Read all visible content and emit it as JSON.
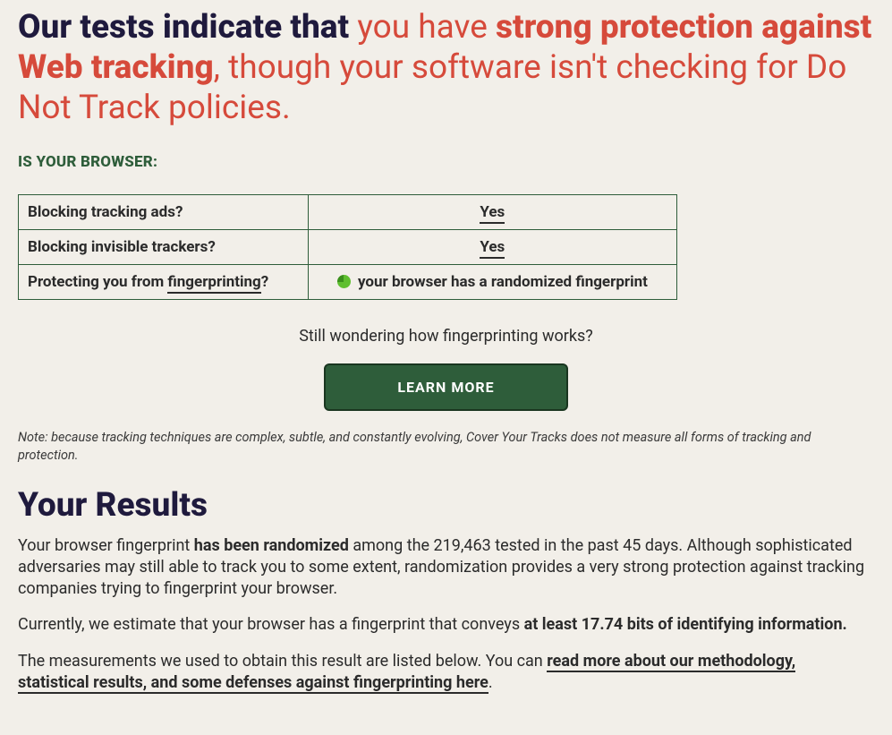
{
  "headline": {
    "lead": "Our tests indicate that ",
    "red1_plain": "you have ",
    "red1_bold": "strong protection against Web tracking",
    "red2_plain": ", though your software isn't checking for Do Not Track policies."
  },
  "section_label": "IS YOUR BROWSER:",
  "table": {
    "rows": [
      {
        "label": "Blocking tracking ads?",
        "value": "Yes"
      },
      {
        "label": "Blocking invisible trackers?",
        "value": "Yes"
      }
    ],
    "fingerprint_row": {
      "label_prefix": "Protecting you from ",
      "label_link": "fingerprinting",
      "label_suffix": "?",
      "value": "your browser has a randomized fingerprint"
    }
  },
  "prompt": "Still wondering how fingerprinting works?",
  "learn_more": "LEARN MORE",
  "note": "Note: because tracking techniques are complex, subtle, and constantly evolving, Cover Your Tracks does not measure all forms of tracking and protection.",
  "results": {
    "heading": "Your Results",
    "p1_a": "Your browser fingerprint ",
    "p1_bold": "has been randomized",
    "p1_b": " among the 219,463 tested in the past 45 days. Although sophisticated adversaries may still able to track you to some extent, randomization provides a very strong protection against tracking companies trying to fingerprint your browser.",
    "p2_a": "Currently, we estimate that your browser has a fingerprint that conveys ",
    "p2_bold": "at least 17.74 bits of identifying information.",
    "p3_a": "The measurements we used to obtain this result are listed below. You can ",
    "p3_link": "read more about our methodology, statistical results, and some defenses against fingerprinting here",
    "p3_b": "."
  }
}
